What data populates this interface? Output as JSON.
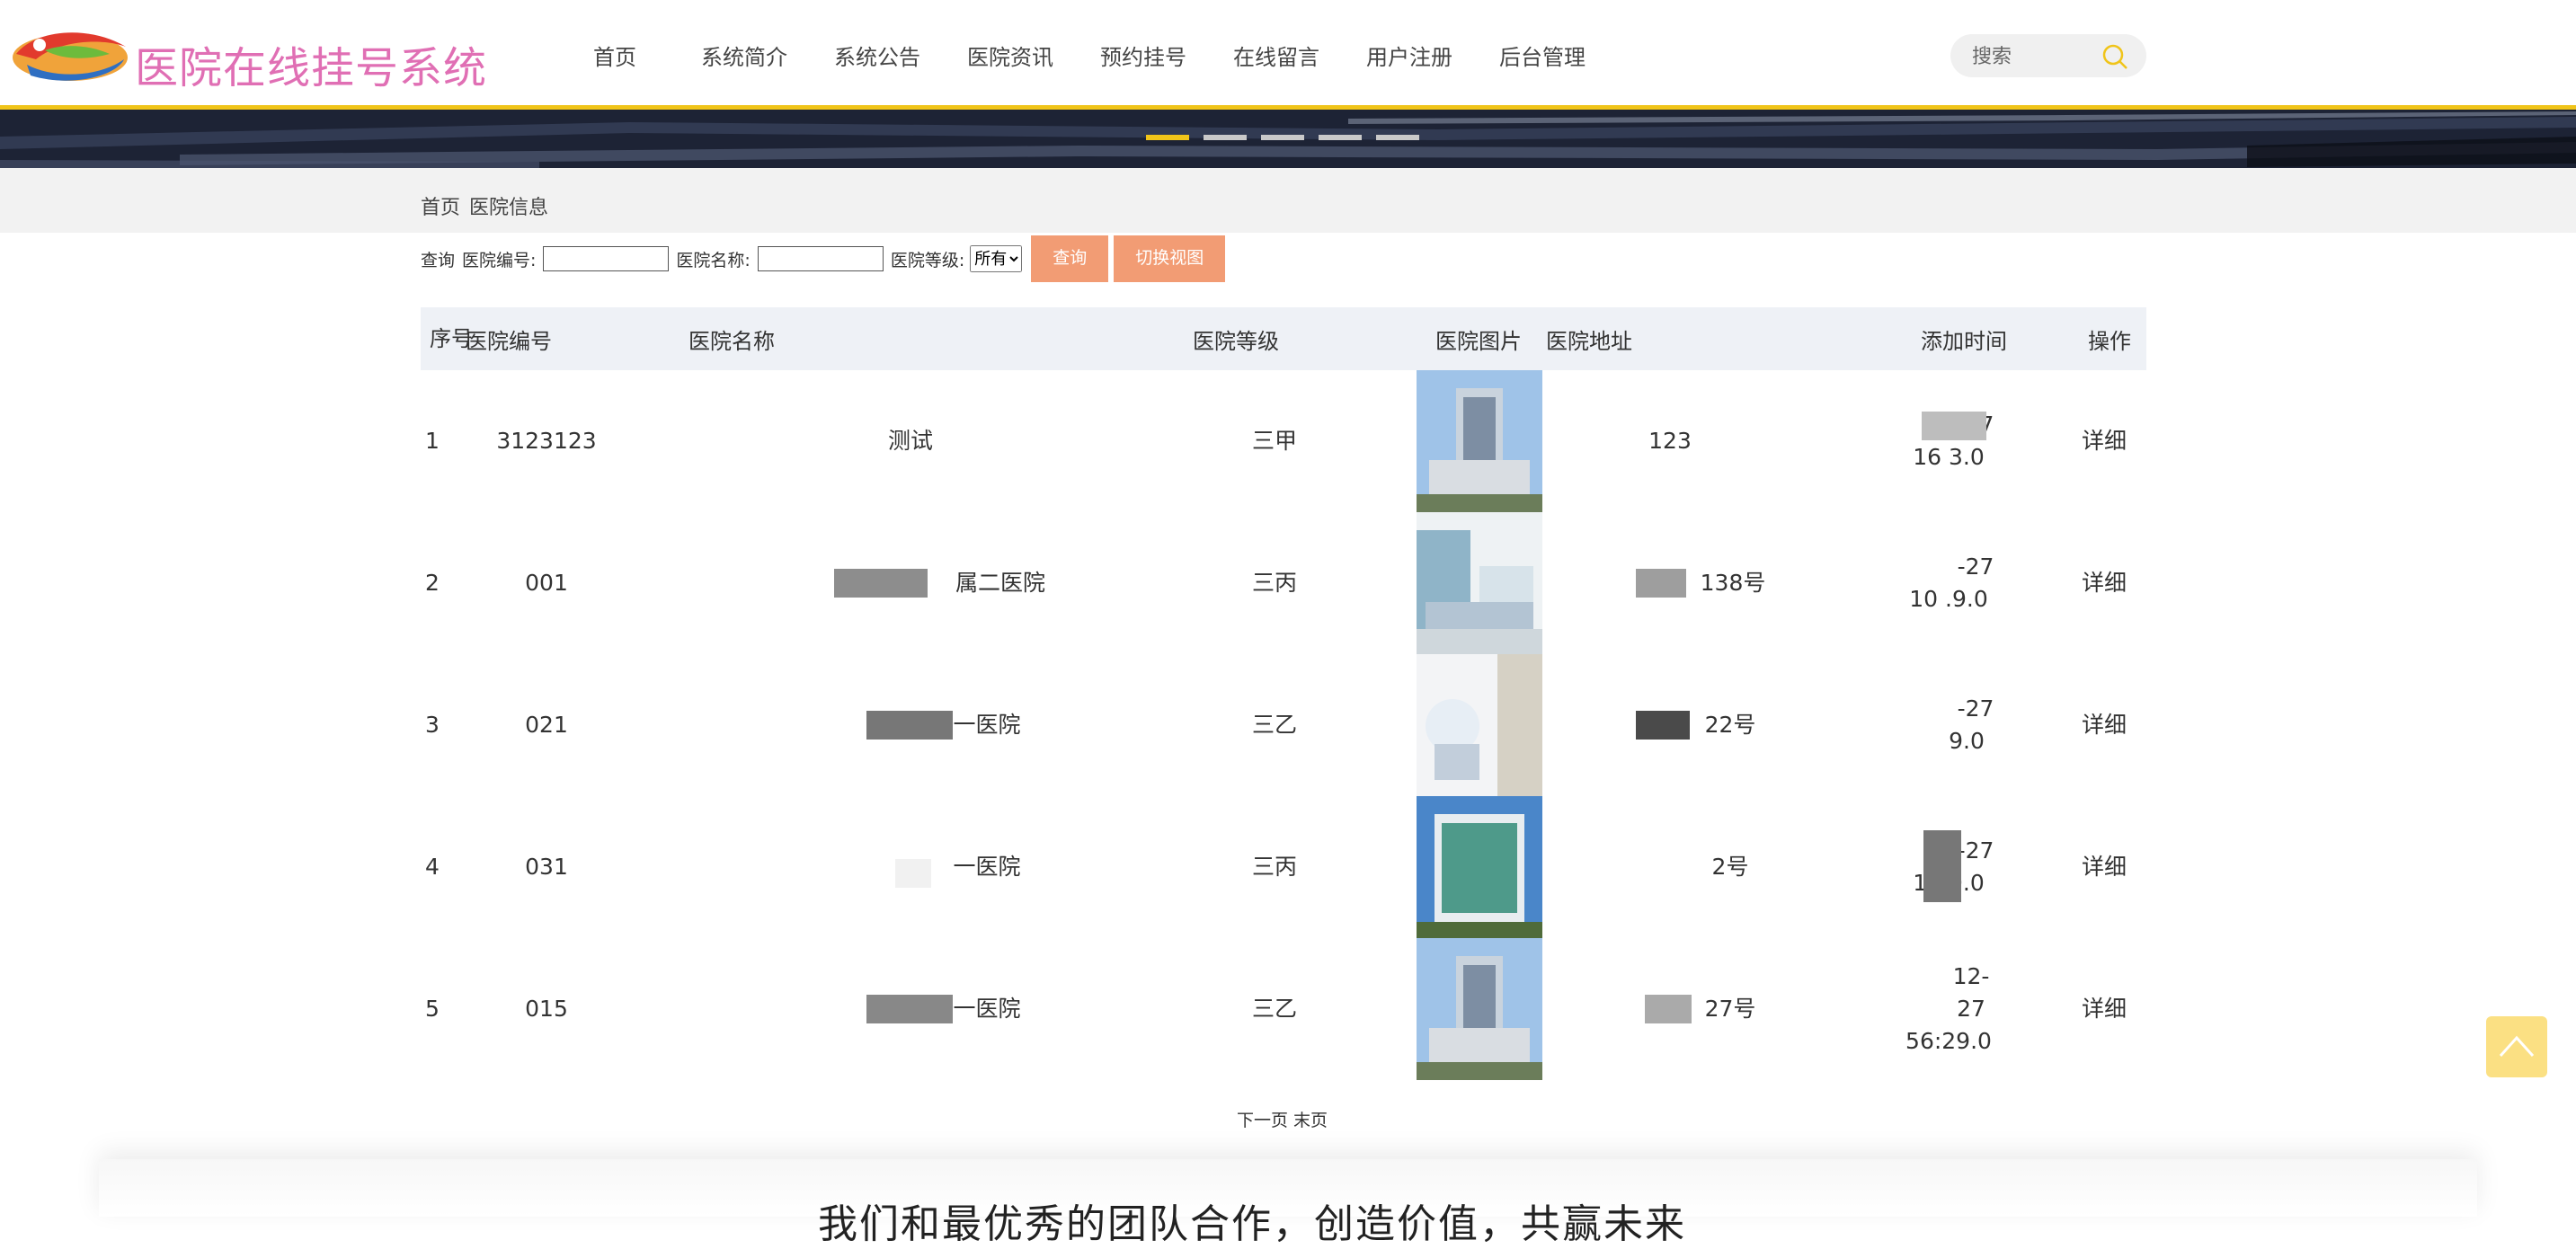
{
  "app": {
    "title": "医院在线挂号系统"
  },
  "nav": [
    "首页",
    "系统简介",
    "系统公告",
    "医院资讯",
    "预约挂号",
    "在线留言",
    "用户注册",
    "后台管理"
  ],
  "search": {
    "placeholder": "搜索"
  },
  "banner": {
    "slide_count": 5,
    "active_slide": 1
  },
  "breadcrumb": [
    "首页",
    "医院信息"
  ],
  "query": {
    "label": "查询",
    "code_label": "医院编号:",
    "code_value": "",
    "name_label": "医院名称:",
    "name_value": "",
    "level_label": "医院等级:",
    "level_selected": "所有",
    "search_button": "查询",
    "toggle_button": "切换视图"
  },
  "table": {
    "headers": {
      "idx": "序号",
      "code": "医院编号",
      "name": "医院名称",
      "level": "医院等级",
      "image": "医院图片",
      "address": "医院地址",
      "time": "添加时间",
      "op": "操作"
    },
    "rows": [
      {
        "idx": "1",
        "code": "3123123",
        "name": "测试",
        "level": "三甲",
        "address": "123",
        "time_a": "-27",
        "time_b": "16   3.0",
        "op": "详细"
      },
      {
        "idx": "2",
        "code": "001",
        "name": "属二医院",
        "level": "三丙",
        "address": "138号",
        "time_a": "-27",
        "time_b": "10   .9.0",
        "op": "详细"
      },
      {
        "idx": "3",
        "code": "021",
        "name": "一医院",
        "level": "三乙",
        "address": "22号",
        "time_a": "-27",
        "time_b": "9.0",
        "op": "详细"
      },
      {
        "idx": "4",
        "code": "031",
        "name": "一医院",
        "level": "三丙",
        "address": "2号",
        "time_a": "-27",
        "time_b": "10   9.0",
        "op": "详细"
      },
      {
        "idx": "5",
        "code": "015",
        "name": "一医院",
        "level": "三乙",
        "address": "27号",
        "time_a": "12-27",
        "time_b": "56:29.0",
        "op": "详细"
      }
    ]
  },
  "pager": {
    "next": "下一页",
    "last": "末页"
  },
  "footer": {
    "slogan": "我们和最优秀的团队合作，创造价值，共赢未来"
  },
  "colors": {
    "accent": "#f0c419",
    "title": "#e06fb4",
    "button": "#f29c74",
    "back_to_top": "#fbe083"
  }
}
